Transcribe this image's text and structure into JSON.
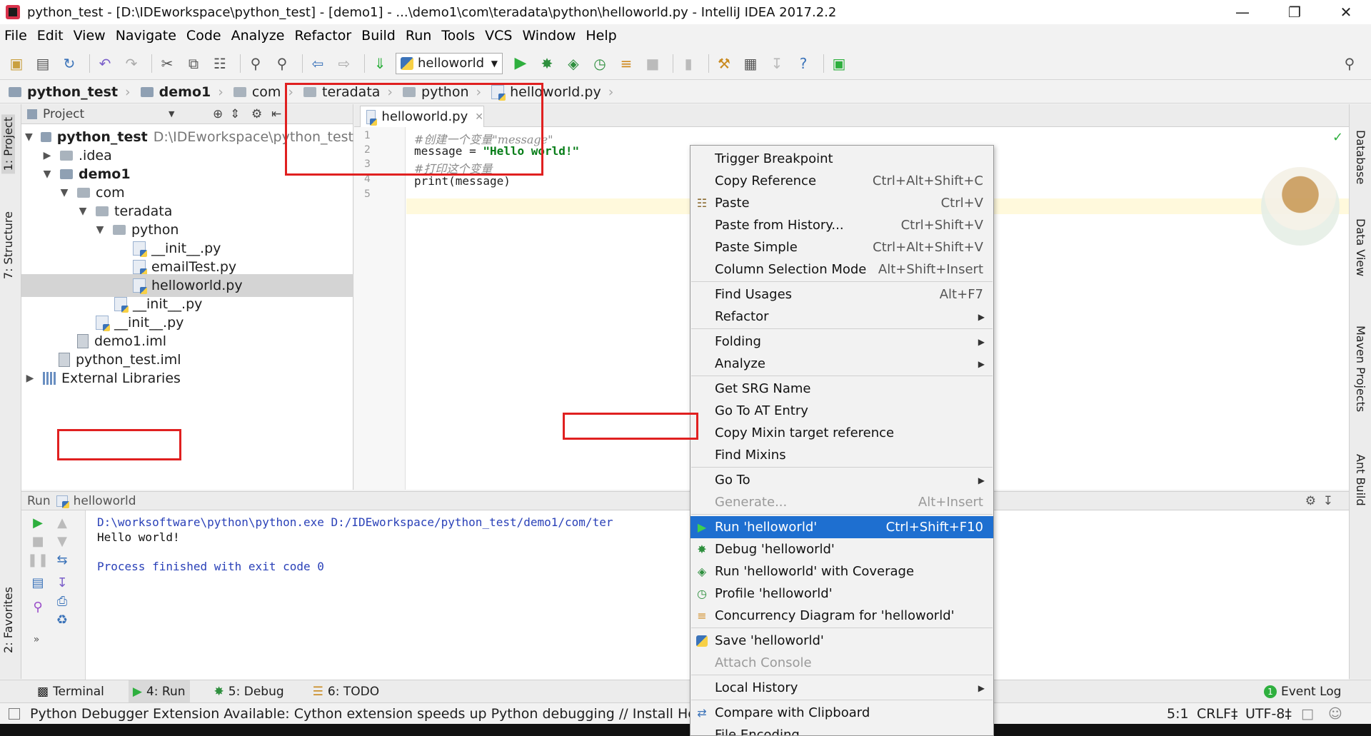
{
  "window": {
    "title": "python_test - [D:\\IDEworkspace\\python_test] - [demo1] - ...\\demo1\\com\\teradata\\python\\helloworld.py - IntelliJ IDEA 2017.2.2",
    "minimize": "—",
    "maximize": "❐",
    "close": "✕"
  },
  "menu": [
    "File",
    "Edit",
    "View",
    "Navigate",
    "Code",
    "Analyze",
    "Refactor",
    "Build",
    "Run",
    "Tools",
    "VCS",
    "Window",
    "Help"
  ],
  "toolbar": {
    "run_config": "helloworld"
  },
  "breadcrumb": [
    "python_test",
    "demo1",
    "com",
    "teradata",
    "python",
    "helloworld.py"
  ],
  "side_tabs": {
    "left": [
      "1: Project",
      "7: Structure",
      "2: Favorites"
    ],
    "right": [
      "Database",
      "Data View",
      "Maven Projects",
      "Ant Build"
    ]
  },
  "project": {
    "header": "Project",
    "tree": [
      {
        "name": "python_test",
        "extra": "D:\\IDEworkspace\\python_test"
      },
      {
        "name": ".idea"
      },
      {
        "name": "demo1"
      },
      {
        "name": "com"
      },
      {
        "name": "teradata"
      },
      {
        "name": "python"
      },
      {
        "name": "__init__.py"
      },
      {
        "name": "emailTest.py"
      },
      {
        "name": "helloworld.py"
      },
      {
        "name": "__init__.py"
      },
      {
        "name": "__init__.py"
      },
      {
        "name": "demo1.iml"
      },
      {
        "name": "python_test.iml"
      },
      {
        "name": "External Libraries"
      }
    ]
  },
  "editor": {
    "tab": "helloworld.py",
    "line_numbers": [
      "1",
      "2",
      "3",
      "4",
      "5"
    ],
    "lines": {
      "l1": "#创建一个变量\"message\"",
      "l2a": "message = ",
      "l2b": "\"Hello world!\"",
      "l3": "#打印这个变量",
      "l4": "print(message)"
    }
  },
  "run_panel": {
    "label": "Run",
    "config": "helloworld",
    "output": [
      "D:\\worksoftware\\python\\python.exe D:/IDEworkspace/python_test/demo1/com/ter",
      "Hello world!",
      "",
      "Process finished with exit code 0"
    ]
  },
  "context_menu": [
    {
      "label": "Trigger Breakpoint",
      "shortcut": ""
    },
    {
      "label": "Copy Reference",
      "shortcut": "Ctrl+Alt+Shift+C"
    },
    {
      "label": "Paste",
      "shortcut": "Ctrl+V",
      "icon": "paste-icon"
    },
    {
      "label": "Paste from History...",
      "shortcut": "Ctrl+Shift+V"
    },
    {
      "label": "Paste Simple",
      "shortcut": "Ctrl+Alt+Shift+V"
    },
    {
      "label": "Column Selection Mode",
      "shortcut": "Alt+Shift+Insert"
    },
    {
      "label": "Find Usages",
      "shortcut": "Alt+F7"
    },
    {
      "label": "Refactor",
      "shortcut": "",
      "submenu": true
    },
    {
      "label": "Folding",
      "shortcut": "",
      "submenu": true
    },
    {
      "label": "Analyze",
      "shortcut": "",
      "submenu": true
    },
    {
      "label": "Get SRG Name",
      "shortcut": ""
    },
    {
      "label": "Go To AT Entry",
      "shortcut": ""
    },
    {
      "label": "Copy Mixin target reference",
      "shortcut": ""
    },
    {
      "label": "Find Mixins",
      "shortcut": ""
    },
    {
      "label": "Go To",
      "shortcut": "",
      "submenu": true
    },
    {
      "label": "Generate...",
      "shortcut": "Alt+Insert",
      "disabled": true
    },
    {
      "label": "Run 'helloworld'",
      "shortcut": "Ctrl+Shift+F10",
      "highlighted": true
    },
    {
      "label": "Debug 'helloworld'",
      "shortcut": ""
    },
    {
      "label": "Run 'helloworld' with Coverage",
      "shortcut": ""
    },
    {
      "label": "Profile 'helloworld'",
      "shortcut": ""
    },
    {
      "label": "Concurrency Diagram for  'helloworld'",
      "shortcut": ""
    },
    {
      "label": "Save 'helloworld'",
      "shortcut": ""
    },
    {
      "label": "Attach Console",
      "shortcut": "",
      "disabled": true
    },
    {
      "label": "Local History",
      "shortcut": "",
      "submenu": true
    },
    {
      "label": "Compare with Clipboard",
      "shortcut": ""
    },
    {
      "label": "File Encoding",
      "shortcut": ""
    }
  ],
  "bottom_tabs": [
    "Terminal",
    "4: Run",
    "5: Debug",
    "6: TODO"
  ],
  "event_log": {
    "count": "1",
    "label": "Event Log"
  },
  "status": {
    "message": "Python Debugger Extension Available: Cython extension speeds up Python debugging // Install How does",
    "position": "5:1",
    "line_sep": "CRLF‡",
    "encoding": "UTF-8‡"
  },
  "colors": {
    "selection": "#1e6fd0",
    "annotation": "#e02020",
    "run_green": "#2eaf3e"
  }
}
